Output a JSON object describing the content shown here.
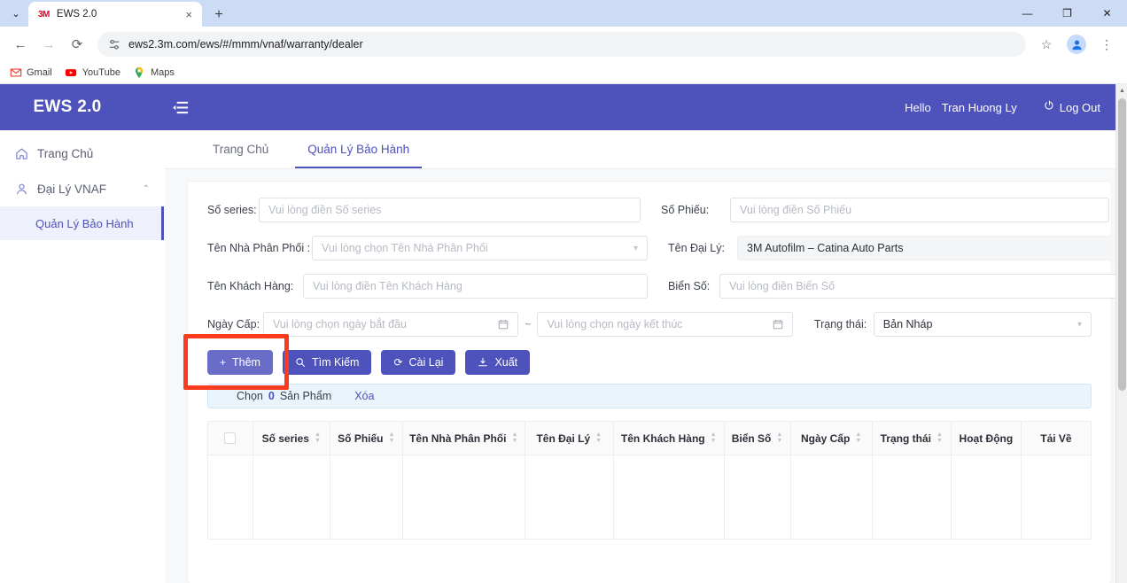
{
  "browser": {
    "tab": {
      "title": "EWS 2.0",
      "favicon_text": "3M",
      "close_label": "×"
    },
    "new_tab_label": "+",
    "tab_search_label": "⌄",
    "window": {
      "minimize": "—",
      "maximize": "❐",
      "close": "✕"
    },
    "nav": {
      "back": "←",
      "forward": "→",
      "reload": "⟳"
    },
    "omnibox": {
      "url": "ews2.3m.com/ews/#/mmm/vnaf/warranty/dealer",
      "site_icon": "site-settings-icon"
    },
    "toolbar_right": {
      "bookmark": "☆",
      "menu": "⋮"
    },
    "bookmarks": [
      {
        "label": "Gmail",
        "icon": "gmail-icon"
      },
      {
        "label": "YouTube",
        "icon": "youtube-icon"
      },
      {
        "label": "Maps",
        "icon": "maps-icon"
      }
    ]
  },
  "appbar": {
    "brand": "EWS 2.0",
    "collapse_icon": "sidebar-collapse-icon",
    "hello": "Hello",
    "user_name": "Tran Huong Ly",
    "logout_label": "Log Out",
    "logout_icon": "power-icon",
    "bg_color": "#4e52bb"
  },
  "sidebar": {
    "items": [
      {
        "label": "Trang Chủ",
        "icon": "home-icon"
      },
      {
        "label": "Đại Lý VNAF",
        "icon": "user-icon",
        "chevron": "⌃"
      }
    ],
    "sub_item": {
      "label": "Quản Lý Bảo Hành",
      "active": true
    }
  },
  "tabs": [
    {
      "label": "Trang Chủ",
      "active": false
    },
    {
      "label": "Quản Lý Bảo Hành",
      "active": true
    }
  ],
  "form": {
    "so_series": {
      "label": "Số series:",
      "placeholder": "Vui lòng điền Số series",
      "value": ""
    },
    "so_phieu": {
      "label": "Số Phiếu:",
      "placeholder": "Vui lòng điền Số Phiếu",
      "value": ""
    },
    "nha_phan_phoi": {
      "label": "Tên Nhà Phân Phối :",
      "placeholder": "Vui lòng chọn Tên Nhà Phân Phối",
      "value": ""
    },
    "dai_ly": {
      "label": "Tên Đại Lý:",
      "value": "3M Autofilm – Catina Auto Parts",
      "readonly": true
    },
    "khach_hang": {
      "label": "Tên Khách Hàng:",
      "placeholder": "Vui lòng điền Tên Khách Hàng",
      "value": ""
    },
    "bien_so": {
      "label": "Biển Số:",
      "placeholder": "Vui lòng điền Biển Số",
      "value": ""
    },
    "ngay_cap": {
      "label": "Ngày Cấp:",
      "start_placeholder": "Vui lòng chọn ngày bắt đầu",
      "end_placeholder": "Vui lòng chọn ngày kết thúc",
      "separator": "~"
    },
    "trang_thai": {
      "label": "Trạng thái:",
      "value": "Bản Nháp"
    }
  },
  "buttons": {
    "them": {
      "label": "Thêm",
      "icon": "plus-icon",
      "glyph": "+",
      "highlighted": true
    },
    "tim_kiem": {
      "label": "Tìm Kiếm",
      "icon": "search-icon",
      "glyph": "⌕"
    },
    "cai_lai": {
      "label": "Cài Lại",
      "icon": "refresh-icon",
      "glyph": "⟳"
    },
    "xuat": {
      "label": "Xuất",
      "icon": "download-icon",
      "glyph": "⤓"
    }
  },
  "selection_bar": {
    "prefix": "Chọn",
    "count": "0",
    "suffix": "Sản Phẩm",
    "delete_label": "Xóa"
  },
  "table": {
    "columns": [
      {
        "label": "",
        "sortable": false,
        "checkbox": true
      },
      {
        "label": "Số series",
        "sortable": true
      },
      {
        "label": "Số Phiếu",
        "sortable": true
      },
      {
        "label": "Tên Nhà Phân Phối",
        "sortable": true
      },
      {
        "label": "Tên Đại Lý",
        "sortable": true
      },
      {
        "label": "Tên Khách Hàng",
        "sortable": true
      },
      {
        "label": "Biển Số",
        "sortable": true
      },
      {
        "label": "Ngày Cấp",
        "sortable": true
      },
      {
        "label": "Trạng thái",
        "sortable": true
      },
      {
        "label": "Hoạt Động",
        "sortable": false
      },
      {
        "label": "Tải Về",
        "sortable": false
      }
    ],
    "rows": []
  },
  "highlight": {
    "color": "#fb3b1e"
  }
}
